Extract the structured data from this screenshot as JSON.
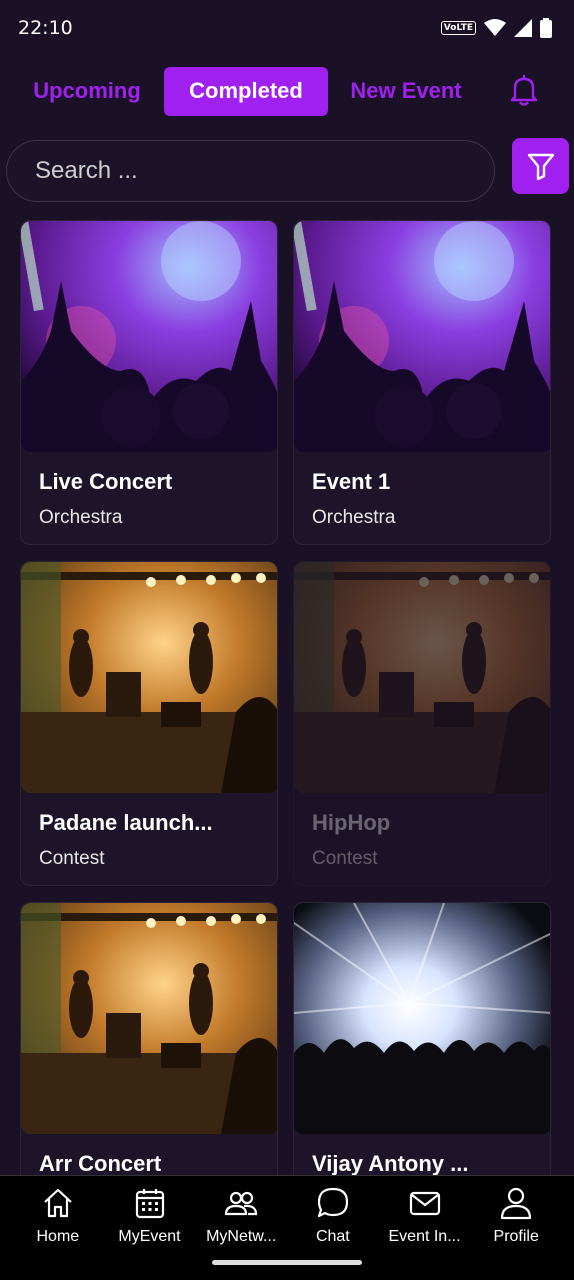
{
  "status_bar": {
    "time": "22:10",
    "network_badge": "VoLTE"
  },
  "tabs": [
    {
      "label": "Upcoming",
      "active": false
    },
    {
      "label": "Completed",
      "active": true
    },
    {
      "label": "New Event",
      "active": false
    }
  ],
  "search": {
    "placeholder": "Search ..."
  },
  "events": [
    {
      "title": "Live Concert",
      "subtitle": "Orchestra",
      "image": "concert-crowd",
      "dimmed": false
    },
    {
      "title": "Event 1",
      "subtitle": "Orchestra",
      "image": "concert-crowd",
      "dimmed": false
    },
    {
      "title": "Padane launch...",
      "subtitle": "Contest",
      "image": "band-on-stage",
      "dimmed": false
    },
    {
      "title": "HipHop",
      "subtitle": "Contest",
      "image": "band-on-stage",
      "dimmed": true
    },
    {
      "title": "Arr Concert",
      "subtitle": "",
      "image": "band-on-stage",
      "dimmed": false
    },
    {
      "title": "Vijay Antony ...",
      "subtitle": "",
      "image": "stage-lights-crowd",
      "dimmed": false
    }
  ],
  "bottom_nav": [
    {
      "label": "Home",
      "icon": "home-icon"
    },
    {
      "label": "MyEvent",
      "icon": "calendar-icon"
    },
    {
      "label": "MyNetw...",
      "icon": "people-icon"
    },
    {
      "label": "Chat",
      "icon": "chat-icon"
    },
    {
      "label": "Event In...",
      "icon": "mail-icon"
    },
    {
      "label": "Profile",
      "icon": "profile-icon"
    }
  ],
  "colors": {
    "accent": "#a020f0",
    "background": "#1a1126",
    "card": "#1d1429"
  }
}
